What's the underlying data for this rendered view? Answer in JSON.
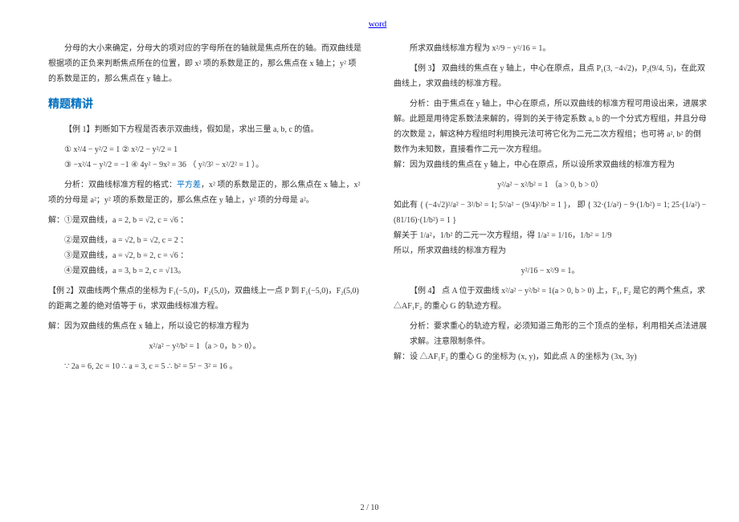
{
  "header": "word",
  "footer": "2 / 10",
  "left": {
    "p1": "分母的大小来确定，分母大的项对应的字母所在的轴就是焦点所在的轴。而双曲线是根据项的正负来判断焦点所在的位置，即 x² 项的系数是正的，那么焦点在 x 轴上；y² 项的系数是正的，那么焦点在 y 轴上。",
    "title": "精题精讲",
    "ex1_title": "【例 1】判断如下方程是否表示双曲线，假如是，求出三量 a, b, c 的值。",
    "ex1_eq1": "① x²/4 − y²/2 = 1  ② x²/2 − y²/2 = 1",
    "ex1_eq2": "③ −x²/4 − y²/2 = −1  ④ 4y² − 9x² = 36  （ y²/3² − x²/2² = 1 ）。",
    "ex1_analysis": "分析：双曲线标准方程的格式：平方差，x² 项的系数是正的，那么焦点在 x 轴上，x² 项的分母是 a²；y² 项的系数是正的，那么焦点在 y 轴上，y² 项的分母是 a²。",
    "ex1_sol1": "解：①是双曲线，a = 2, b = √2, c = √6 ：",
    "ex1_sol2": "②是双曲线，a = √2, b = √2, c = 2 ：",
    "ex1_sol3": "③是双曲线，a = √2, b = 2, c = √6 ：",
    "ex1_sol4": "④是双曲线，a = 3, b = 2, c = √13。",
    "ex2_title": "【例 2】双曲线两个焦点的坐标为 F₁(−5,0)，F₂(5,0)，双曲线上一点 P 到 F₁(−5,0)，F₂(5,0) 的距离之差的绝对值等于 6，求双曲线标准方程。",
    "ex2_line1": "解：因为双曲线的焦点在 x 轴上，所以设它的标准方程为",
    "ex2_eq": "x²/a² − y²/b² = 1（a > 0，b > 0）。",
    "ex2_line2": "∵ 2a = 6, 2c = 10 ∴ a = 3, c = 5 ∴ b² = 5² − 3² = 16 。"
  },
  "right": {
    "p1": "所求双曲线标准方程为 x²/9 − y²/16 = 1。",
    "ex3_title": "【例 3】 双曲线的焦点在 y 轴上，中心在原点，且点 P₁(3, −4√2)，P₂(9/4, 5)，在此双曲线上，求双曲线的标准方程。",
    "ex3_analysis": "分析：由于焦点在 y 轴上，中心在原点，所以双曲线的标准方程可用设出来，进展求解。此题是用待定系数法来解的，得到的关于待定系数 a, b 的一个分式方程组，并且分母的次数是 2，解这种方程组时利用换元法可将它化为二元二次方程组；也可将 a², b² 的倒数作为未知数，直接看作二元一次方程组。",
    "ex3_sol_line1": "解：因为双曲线的焦点在 y 轴上，中心在原点，所以设所求双曲线的标准方程为",
    "ex3_sol_eq1": "y²/a² − x²/b² = 1    （a > 0, b > 0）",
    "ex3_sol_line2": "如此有 { (−4√2)²/a² − 3²/b² = 1;   5²/a² − (9/4)²/b² = 1 }，   即 { 32·(1/a²) − 9·(1/b²) = 1;   25·(1/a²) − (81/16)·(1/b²) = 1 }",
    "ex3_sol_line3": "解关于 1/a²，1/b² 的二元一次方程组，得 1/a² = 1/16，1/b² = 1/9",
    "ex3_sol_line4": "所以，所求双曲线的标准方程为",
    "ex3_sol_eq2": "y²/16 − x²/9 = 1。",
    "ex4_title": "【例 4】 点 A 位于双曲线 x²/a² − y²/b² = 1(a > 0, b > 0) 上，F₁, F₂ 是它的两个焦点，求 △AF₁F₂ 的重心 G 的轨迹方程。",
    "ex4_analysis": "分析：要求重心的轨迹方程，必须知道三角形的三个顶点的坐标，利用相关点法进展求解。注意限制条件。",
    "ex4_sol": "解：设 △AF₁F₂ 的重心 G 的坐标为 (x, y)，如此点 A 的坐标为 (3x, 3y)"
  }
}
